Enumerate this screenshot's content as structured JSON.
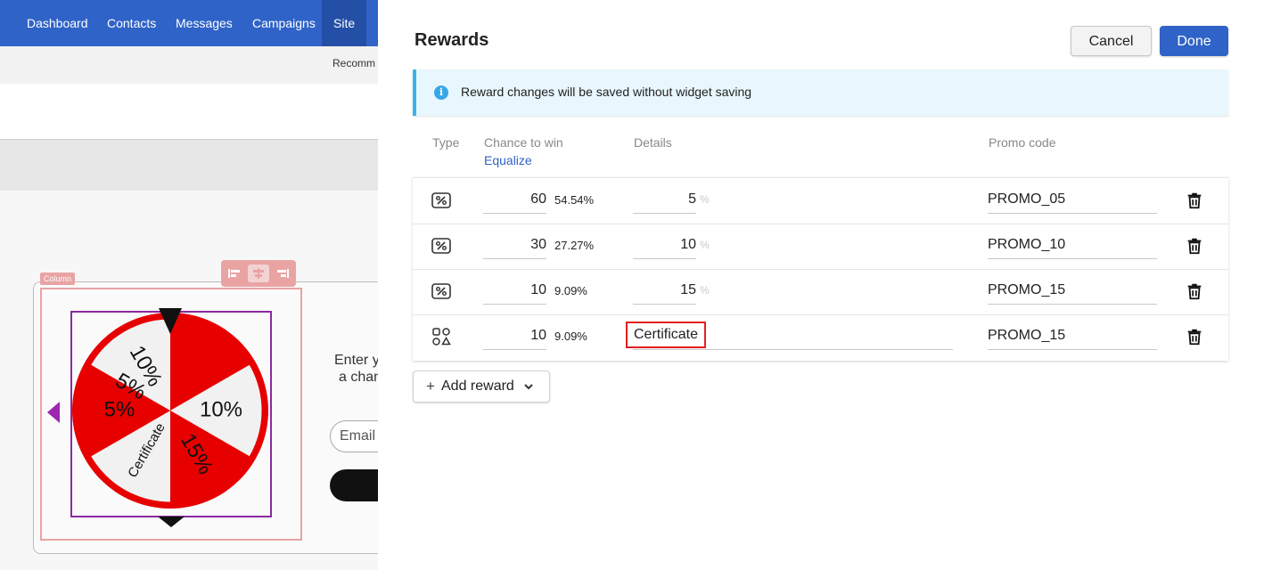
{
  "background": {
    "nav": [
      "Dashboard",
      "Contacts",
      "Messages",
      "Campaigns",
      "Site"
    ],
    "active_nav": "Site",
    "subbar_text": "Recomm",
    "column_tag": "Column",
    "form_text_line1": "Enter y",
    "form_text_line2": "a chan",
    "email_placeholder": "Email",
    "wheel_segments": [
      "5%",
      "10%",
      "15%",
      "Certificate",
      "5%",
      "10%"
    ]
  },
  "panel": {
    "title": "Rewards",
    "cancel_label": "Cancel",
    "done_label": "Done",
    "info_text": "Reward changes will be saved without widget saving",
    "columns": {
      "type": "Type",
      "chance": "Chance to win",
      "equalize": "Equalize",
      "details": "Details",
      "promo": "Promo code"
    },
    "rows": [
      {
        "type_icon": "discount-percent-icon",
        "chance": "60",
        "percent": "54.54%",
        "details": "5",
        "unit": "%",
        "promo": "PROMO_05"
      },
      {
        "type_icon": "discount-percent-icon",
        "chance": "30",
        "percent": "27.27%",
        "details": "10",
        "unit": "%",
        "promo": "PROMO_10"
      },
      {
        "type_icon": "discount-percent-icon",
        "chance": "10",
        "percent": "9.09%",
        "details": "15",
        "unit": "%",
        "promo": "PROMO_15"
      },
      {
        "type_icon": "custom-shapes-icon",
        "chance": "10",
        "percent": "9.09%",
        "details": "Certificate",
        "unit": "",
        "promo": "PROMO_15"
      }
    ],
    "add_reward_label": "Add reward",
    "colors": {
      "accent": "#2f63c7",
      "info_border": "#3bb3ea",
      "highlight": "#e02020",
      "wheel_red": "#e60000"
    }
  }
}
